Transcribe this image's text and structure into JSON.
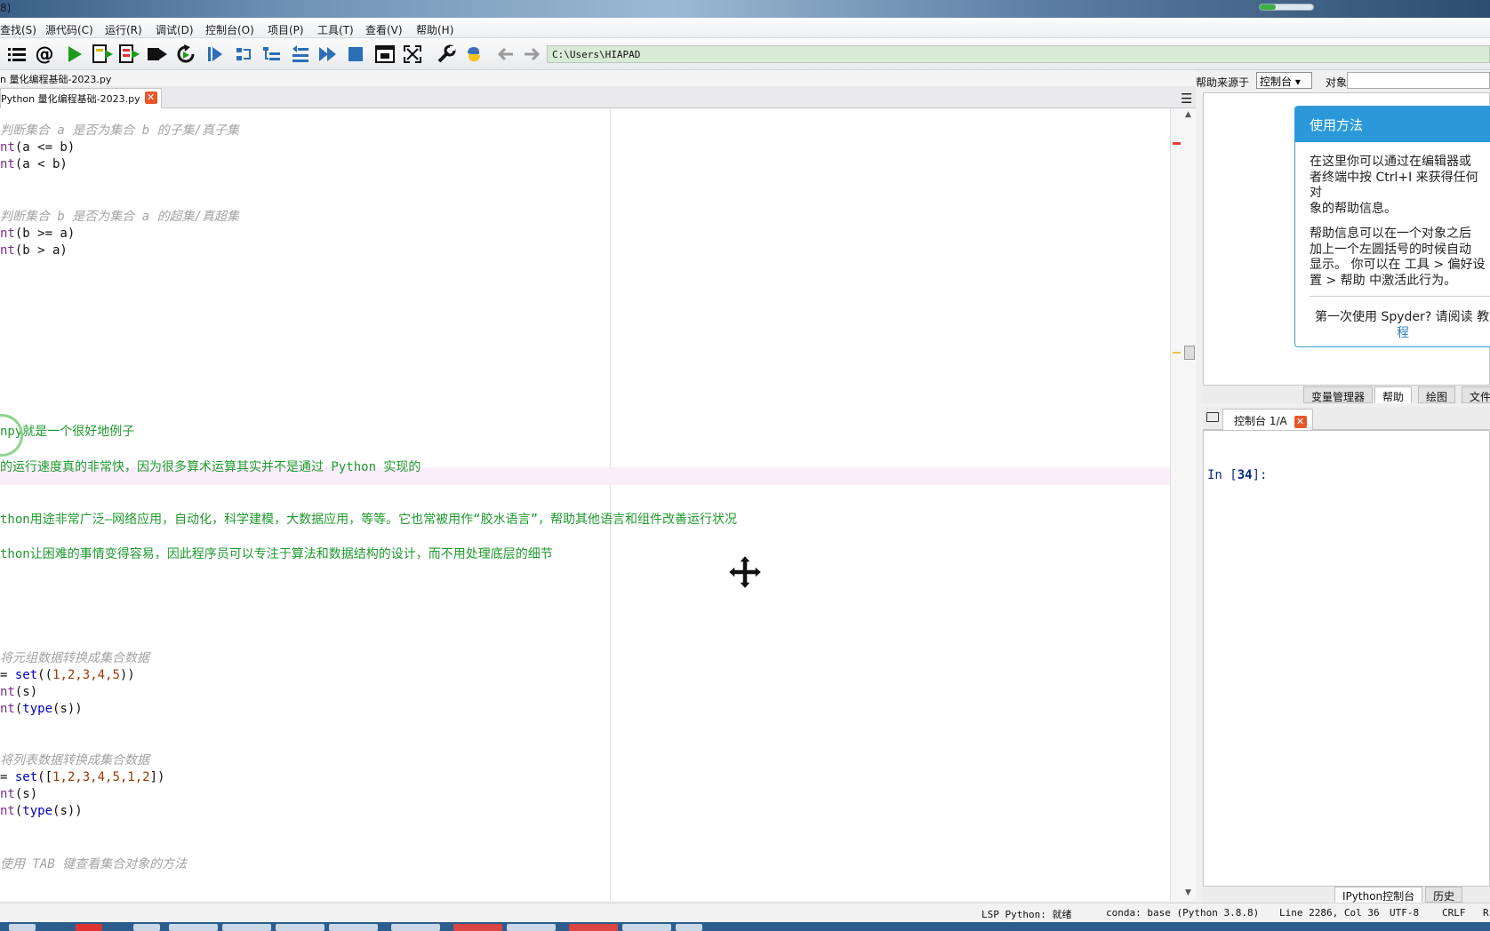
{
  "title_fragment": "8)",
  "menubar": [
    "查找(S)",
    "源代码(C)",
    "运行(R)",
    "调试(D)",
    "控制台(O)",
    "项目(P)",
    "工具(T)",
    "查看(V)",
    "帮助(H)"
  ],
  "toolbar": {
    "path": "C:\\Users\\HIAPAD",
    "icons": [
      "outline-icon",
      "at-icon",
      "run-icon",
      "run-cell-icon",
      "run-cell-advance-icon",
      "run-selection-icon",
      "rerun-icon",
      "debug-icon",
      "step-icon",
      "step-into-icon",
      "step-return-icon",
      "continue-icon",
      "stop-icon",
      "maximize-pane-icon",
      "fullscreen-icon",
      "preferences-icon",
      "python-path-icon",
      "back-icon",
      "forward-icon"
    ]
  },
  "editor": {
    "file_path": "n 量化编程基础-2023.py",
    "tab_label": "Python 量化编程基础-2023.py",
    "lines": [
      {
        "parts": [
          [
            "cm",
            "判断集合 a 是否为集合 b 的子集/真子集"
          ]
        ]
      },
      {
        "parts": [
          [
            "pu",
            "nt"
          ],
          [
            "",
            "(a <= b)"
          ]
        ]
      },
      {
        "parts": [
          [
            "pu",
            "nt"
          ],
          [
            "",
            "(a < b)"
          ]
        ]
      },
      {
        "parts": [
          [
            "cm",
            "判断集合 b 是否为集合 a 的超集/真超集"
          ]
        ]
      },
      {
        "parts": [
          [
            "pu",
            "nt"
          ],
          [
            "",
            "(b >= a)"
          ]
        ]
      },
      {
        "parts": [
          [
            "pu",
            "nt"
          ],
          [
            "",
            "(b > a)"
          ]
        ]
      },
      {
        "parts": [
          [
            "gr",
            "npy就是一个很好地例子"
          ]
        ]
      },
      {
        "parts": [
          [
            "gr",
            "的运行速度真的非常快，因为很多算术运算其实并不是通过 Python 实现的"
          ]
        ]
      },
      {
        "parts": [
          [
            "gr",
            "thon用途非常广泛—网络应用，自动化，科学建模，大数据应用，等等。它也常被用作“胶水语言”，帮助其他语言和组件改善运行状况"
          ]
        ]
      },
      {
        "parts": [
          [
            "gr",
            "thon让困难的事情变得容易，因此程序员可以专注于算法和数据结构的设计，而不用处理底层的细节"
          ]
        ]
      },
      {
        "parts": [
          [
            "cm",
            "将元组数据转换成集合数据"
          ]
        ]
      },
      {
        "parts": [
          [
            "",
            "= "
          ],
          [
            "ke",
            "set"
          ],
          [
            "",
            "(("
          ],
          [
            "nu",
            "1,2,3,4,5"
          ],
          [
            "",
            "))"
          ]
        ]
      },
      {
        "parts": [
          [
            "pu",
            "nt"
          ],
          [
            "",
            "(s)"
          ]
        ]
      },
      {
        "parts": [
          [
            "pu",
            "nt"
          ],
          [
            "",
            "("
          ],
          [
            "ke",
            "type"
          ],
          [
            "",
            "(s))"
          ]
        ]
      },
      {
        "parts": [
          [
            "cm",
            "将列表数据转换成集合数据"
          ]
        ]
      },
      {
        "parts": [
          [
            "",
            "= "
          ],
          [
            "ke",
            "set"
          ],
          [
            "",
            "(["
          ],
          [
            "nu",
            "1,2,3,4,5,1,2"
          ],
          [
            "",
            "])"
          ]
        ]
      },
      {
        "parts": [
          [
            "pu",
            "nt"
          ],
          [
            "",
            "(s)"
          ]
        ]
      },
      {
        "parts": [
          [
            "pu",
            "nt"
          ],
          [
            "",
            "("
          ],
          [
            "ke",
            "type"
          ],
          [
            "",
            "(s))"
          ]
        ]
      },
      {
        "parts": [
          [
            "cm",
            "使用 TAB 键查看集合对象的方法"
          ]
        ]
      }
    ]
  },
  "help": {
    "source_label": "帮助来源于",
    "source_value": "控制台",
    "object_label": "对象",
    "card_title": "使用方法",
    "para1": [
      "在这里你可以通过在编辑器或",
      "者终端中按 Ctrl+I 来获得任何对",
      "象的帮助信息。"
    ],
    "para2": [
      "帮助信息可以在一个对象之后",
      "加上一个左圆括号的时候自动",
      "显示。 你可以在 工具 > 偏好设",
      "置 > 帮助 中激活此行为。"
    ],
    "para3": [
      "第一次使用 Spyder? 请阅读 教",
      "程"
    ]
  },
  "pane_tabs": [
    "变量管理器",
    "帮助",
    "绘图",
    "文件"
  ],
  "console": {
    "tab_label": "控制台 1/A",
    "prompt_prefix": "In [",
    "prompt_num": "34",
    "prompt_suffix": "]:"
  },
  "bottom_tabs": [
    "IPython控制台",
    "历史"
  ],
  "status": {
    "lsp": "LSP Python: 就绪",
    "conda": "conda: base (Python 3.8.8)",
    "position": "Line 2286, Col 36",
    "encoding": "UTF-8",
    "eol": "CRLF",
    "rw": "R"
  }
}
